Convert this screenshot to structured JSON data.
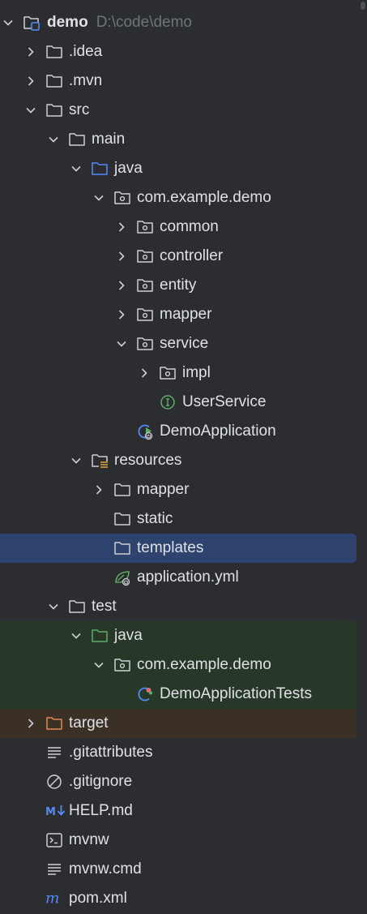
{
  "colors": {
    "background": "#2b2d30",
    "selection": "#2e436e",
    "test_tint": "#273828",
    "excluded_tint": "#3b3026",
    "path_text": "#6f737a",
    "folder_source": "#548af7",
    "folder_test": "#5fad65",
    "folder_excluded": "#e08855",
    "interface_icon": "#5fad65"
  },
  "project": {
    "name": "demo",
    "path": "D:\\code\\demo"
  },
  "tree": [
    {
      "label": ".idea",
      "level": 1,
      "icon": "folder-icon",
      "expanded": false
    },
    {
      "label": ".mvn",
      "level": 1,
      "icon": "folder-icon",
      "expanded": false
    },
    {
      "label": "src",
      "level": 1,
      "icon": "folder-icon",
      "expanded": true
    },
    {
      "label": "main",
      "level": 2,
      "icon": "folder-icon",
      "expanded": true
    },
    {
      "label": "java",
      "level": 3,
      "icon": "source-folder-icon",
      "expanded": true
    },
    {
      "label": "com.example.demo",
      "level": 4,
      "icon": "package-icon",
      "expanded": true
    },
    {
      "label": "common",
      "level": 5,
      "icon": "package-icon",
      "expanded": false
    },
    {
      "label": "controller",
      "level": 5,
      "icon": "package-icon",
      "expanded": false
    },
    {
      "label": "entity",
      "level": 5,
      "icon": "package-icon",
      "expanded": false
    },
    {
      "label": "mapper",
      "level": 5,
      "icon": "package-icon",
      "expanded": false
    },
    {
      "label": "service",
      "level": 5,
      "icon": "package-icon",
      "expanded": true
    },
    {
      "label": "impl",
      "level": 6,
      "icon": "package-icon",
      "expanded": false
    },
    {
      "label": "UserService",
      "level": 6,
      "icon": "interface-icon",
      "leaf": true
    },
    {
      "label": "DemoApplication",
      "level": 5,
      "icon": "spring-boot-app-icon",
      "leaf": true
    },
    {
      "label": "resources",
      "level": 3,
      "icon": "resources-folder-icon",
      "expanded": true
    },
    {
      "label": "mapper",
      "level": 4,
      "icon": "folder-icon",
      "expanded": false
    },
    {
      "label": "static",
      "level": 4,
      "icon": "folder-icon",
      "leaf": true
    },
    {
      "label": "templates",
      "level": 4,
      "icon": "folder-icon",
      "leaf": true,
      "selected": true
    },
    {
      "label": "application.yml",
      "level": 4,
      "icon": "spring-config-icon",
      "leaf": true
    },
    {
      "label": "test",
      "level": 2,
      "icon": "folder-icon",
      "expanded": true
    },
    {
      "label": "java",
      "level": 3,
      "icon": "test-folder-icon",
      "expanded": true,
      "tint": "test"
    },
    {
      "label": "com.example.demo",
      "level": 4,
      "icon": "package-icon",
      "expanded": true,
      "tint": "test"
    },
    {
      "label": "DemoApplicationTests",
      "level": 5,
      "icon": "test-class-icon",
      "leaf": true,
      "tint": "test"
    },
    {
      "label": "target",
      "level": 1,
      "icon": "excluded-folder-icon",
      "expanded": false,
      "tint": "excluded"
    },
    {
      "label": ".gitattributes",
      "level": 1,
      "icon": "text-file-icon",
      "leaf": true
    },
    {
      "label": ".gitignore",
      "level": 1,
      "icon": "ignore-file-icon",
      "leaf": true
    },
    {
      "label": "HELP.md",
      "level": 1,
      "icon": "markdown-icon",
      "leaf": true
    },
    {
      "label": "mvnw",
      "level": 1,
      "icon": "shell-script-icon",
      "leaf": true
    },
    {
      "label": "mvnw.cmd",
      "level": 1,
      "icon": "text-file-icon",
      "leaf": true
    },
    {
      "label": "pom.xml",
      "level": 1,
      "icon": "maven-icon",
      "leaf": true
    }
  ]
}
